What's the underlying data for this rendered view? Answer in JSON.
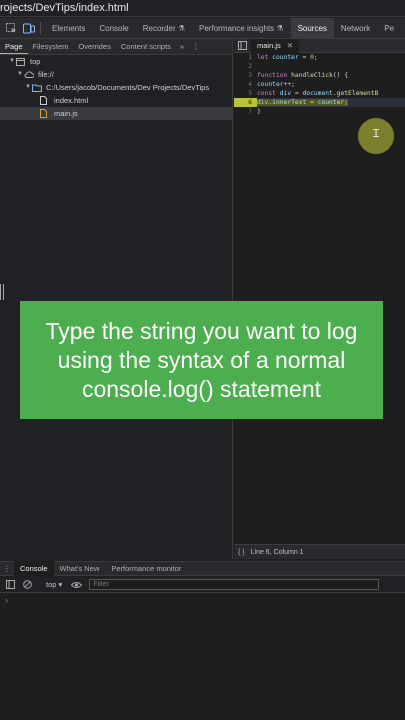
{
  "titlebar": {
    "path": "rojects/DevTips/index.html"
  },
  "devtools_tabs": [
    {
      "label": "Elements",
      "active": false
    },
    {
      "label": "Console",
      "active": false
    },
    {
      "label": "Recorder ⚗",
      "active": false
    },
    {
      "label": "Performance insights ⚗",
      "active": false
    },
    {
      "label": "Sources",
      "active": true
    },
    {
      "label": "Network",
      "active": false
    },
    {
      "label": "Pe",
      "active": false
    }
  ],
  "sources_subtabs": [
    {
      "label": "Page",
      "active": true
    },
    {
      "label": "Filesystem",
      "active": false
    },
    {
      "label": "Overrides",
      "active": false
    },
    {
      "label": "Content scripts",
      "active": false
    }
  ],
  "sources_more": "»",
  "file_tree": [
    {
      "label": "top",
      "indent": 1,
      "expanded": true,
      "icon": "frame-icon"
    },
    {
      "label": "file://",
      "indent": 2,
      "expanded": true,
      "icon": "cloud-icon"
    },
    {
      "label": "C:/Users/jacob/Documents/Dev Projects/DevTips",
      "indent": 3,
      "expanded": true,
      "icon": "folder-icon"
    },
    {
      "label": "index.html",
      "indent": 4,
      "expanded": null,
      "icon": "file-icon",
      "selected": false
    },
    {
      "label": "main.js",
      "indent": 4,
      "expanded": null,
      "icon": "js-file-icon",
      "selected": true
    }
  ],
  "editor": {
    "tab_label": "main.js",
    "lines": [
      {
        "num": "1",
        "code": "let counter = 0;"
      },
      {
        "num": "2",
        "code": ""
      },
      {
        "num": "3",
        "code": "function handleClick() {"
      },
      {
        "num": "4",
        "code": "  counter++;"
      },
      {
        "num": "5",
        "code": "  const div = document.getElementB"
      },
      {
        "num": "6",
        "code": "  div.innerText = counter;",
        "current": true
      },
      {
        "num": "7",
        "code": "}"
      }
    ]
  },
  "status_bar": {
    "position": "Line 6, Column 1"
  },
  "drawer": {
    "tabs": [
      {
        "label": "Console",
        "active": true
      },
      {
        "label": "What's New",
        "active": false
      },
      {
        "label": "Performance monitor",
        "active": false
      }
    ]
  },
  "console": {
    "context": "top ▾",
    "filter_placeholder": "Filter",
    "prompt": "›"
  },
  "caption": {
    "text": "Type the string you want to log using the syntax of a normal console.log() statement"
  },
  "colors": {
    "caption_bg": "#4cae4f",
    "accent": "#8ab4f8",
    "cursor_highlight": "#c8d23c"
  }
}
